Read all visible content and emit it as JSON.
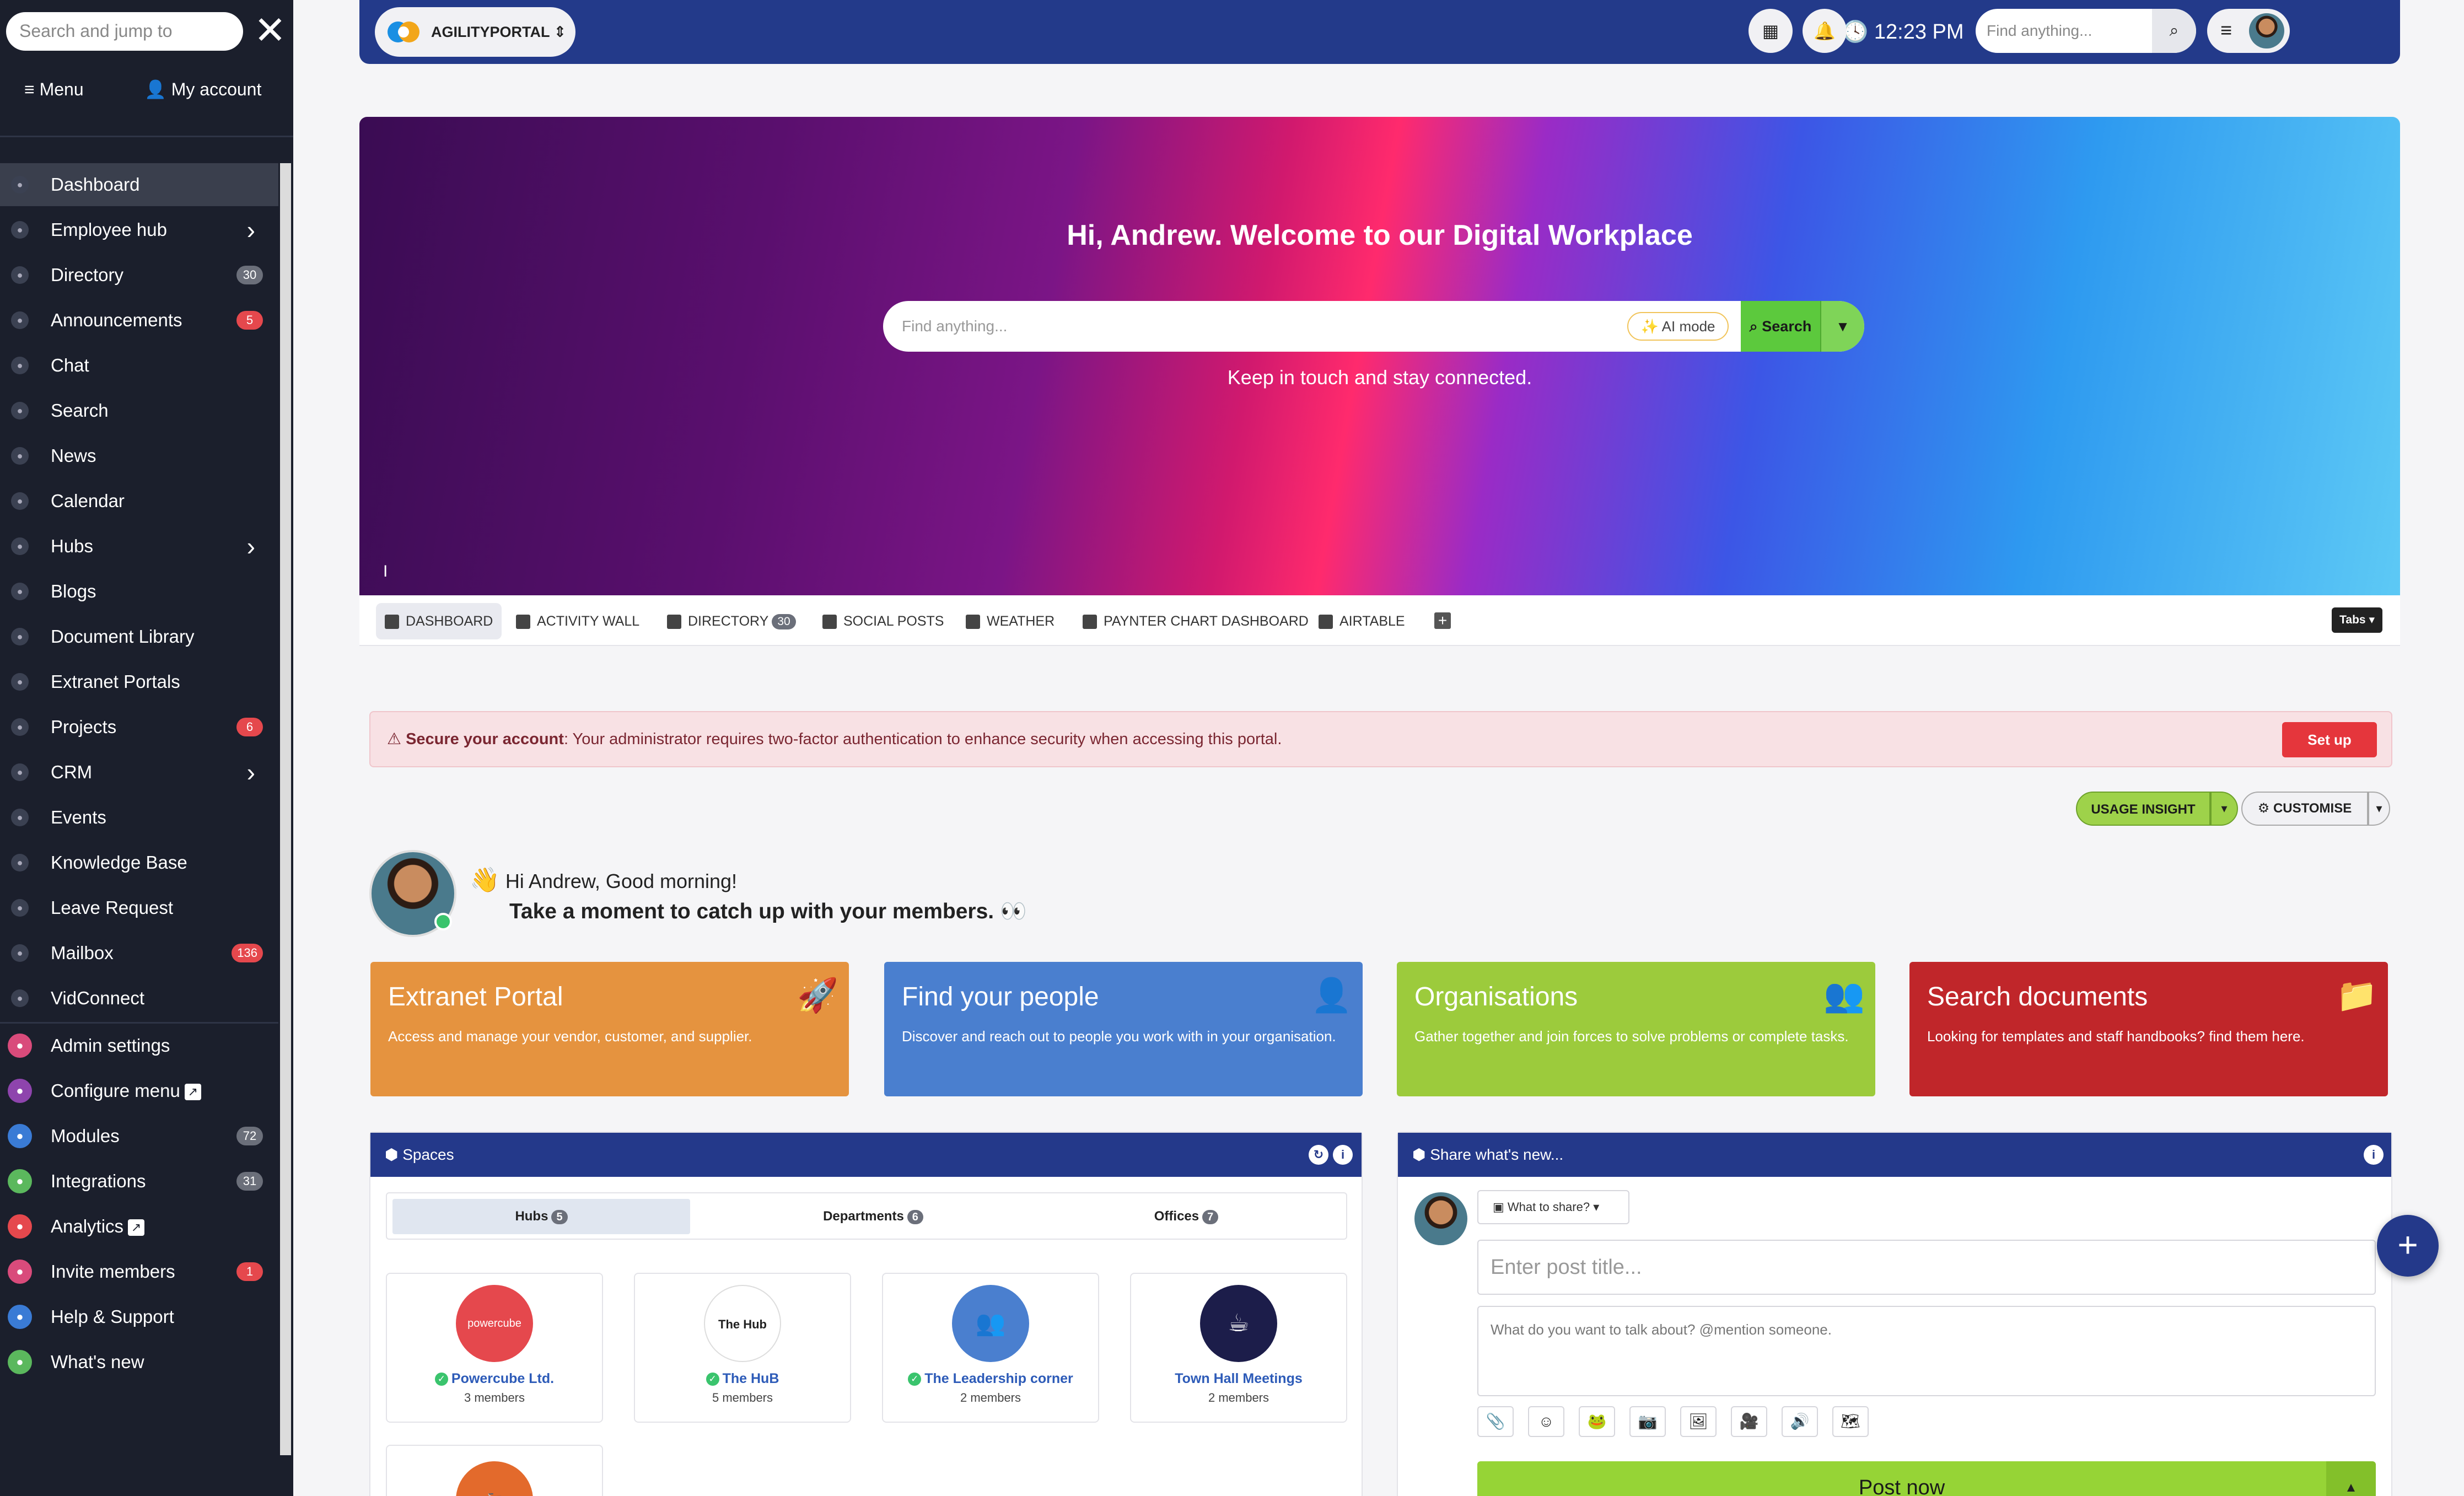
{
  "sidebar": {
    "search_placeholder": "Search and jump to",
    "close_glyph": "✕",
    "menu_label": "Menu",
    "account_label": "My account",
    "items": [
      {
        "label": "Dashboard",
        "icon": "dashboard-icon",
        "active": true
      },
      {
        "label": "Employee hub",
        "icon": "people-icon",
        "chevron": true
      },
      {
        "label": "Directory",
        "icon": "directory-icon",
        "badge": "30",
        "badge_color": "#6b6f7a"
      },
      {
        "label": "Announcements",
        "icon": "megaphone-icon",
        "badge": "5",
        "badge_color": "#e5484d"
      },
      {
        "label": "Chat",
        "icon": "chat-icon"
      },
      {
        "label": "Search",
        "icon": "search-icon"
      },
      {
        "label": "News",
        "icon": "news-icon"
      },
      {
        "label": "Calendar",
        "icon": "calendar-icon"
      },
      {
        "label": "Hubs",
        "icon": "hubs-icon",
        "chevron": true
      },
      {
        "label": "Blogs",
        "icon": "blog-icon"
      },
      {
        "label": "Document Library",
        "icon": "folder-icon"
      },
      {
        "label": "Extranet Portals",
        "icon": "portal-icon"
      },
      {
        "label": "Projects",
        "icon": "projects-icon",
        "badge": "6",
        "badge_color": "#e5484d"
      },
      {
        "label": "CRM",
        "icon": "crm-icon",
        "chevron": true
      },
      {
        "label": "Events",
        "icon": "events-icon"
      },
      {
        "label": "Knowledge Base",
        "icon": "book-icon"
      },
      {
        "label": "Leave Request",
        "icon": "plane-icon"
      },
      {
        "label": "Mailbox",
        "icon": "mailbox-icon",
        "badge": "136",
        "badge_color": "#e5484d"
      },
      {
        "label": "VidConnect",
        "icon": "video-icon"
      }
    ],
    "admin_items": [
      {
        "label": "Admin settings",
        "icon": "settings-icon",
        "color": "#d94b7b"
      },
      {
        "label": "Configure menu",
        "icon": "menu-icon",
        "color": "#8e44ad",
        "external": true
      },
      {
        "label": "Modules",
        "icon": "modules-icon",
        "color": "#3a7bd5",
        "badge": "72",
        "badge_color": "#6b6f7a"
      },
      {
        "label": "Integrations",
        "icon": "plug-icon",
        "color": "#5bb85d",
        "badge": "31",
        "badge_color": "#6b6f7a"
      },
      {
        "label": "Analytics",
        "icon": "analytics-icon",
        "color": "#e5484d",
        "external": true
      },
      {
        "label": "Invite members",
        "icon": "invite-icon",
        "color": "#d94b7b",
        "badge": "1",
        "badge_color": "#e5484d"
      },
      {
        "label": "Help & Support",
        "icon": "help-icon",
        "color": "#3a7bd5"
      },
      {
        "label": "What's new",
        "icon": "bulb-icon",
        "color": "#5bb85d"
      }
    ]
  },
  "topbar": {
    "portal_name": "AGILITYPORTAL",
    "time": "12:23 PM",
    "search_placeholder": "Find anything..."
  },
  "hero": {
    "title": "Hi, Andrew. Welcome to our Digital Workplace",
    "search_placeholder": "Find anything...",
    "ai_mode": "AI mode",
    "search_button": "Search",
    "subtitle": "Keep in touch and stay connected.",
    "cursor": "I"
  },
  "tabs": [
    {
      "label": "DASHBOARD",
      "icon": "home-icon",
      "active": true
    },
    {
      "label": "ACTIVITY WALL",
      "icon": "list-icon"
    },
    {
      "label": "DIRECTORY",
      "icon": "directory-icon",
      "badge": "30"
    },
    {
      "label": "SOCIAL POSTS",
      "icon": "square-icon"
    },
    {
      "label": "WEATHER",
      "icon": "square-icon"
    },
    {
      "label": "PAYNTER CHART DASHBOARD",
      "icon": "square-icon"
    },
    {
      "label": "AIRTABLE",
      "icon": "square-icon"
    }
  ],
  "tabs_dropdown": "Tabs ▾",
  "alert": {
    "title": "Secure your account",
    "message": ": Your administrator requires two-factor authentication to enhance security when accessing this portal.",
    "button": "Set up"
  },
  "actions": {
    "usage": "USAGE INSIGHT",
    "customise": "CUSTOMISE"
  },
  "greeting": {
    "line1": "Hi Andrew, Good morning!",
    "line2": "Take a moment to catch up with your members.",
    "wave": "👋",
    "eyes": "👀"
  },
  "cards": [
    {
      "title": "Extranet Portal",
      "desc": "Access and manage your vendor, customer, and supplier.",
      "color": "#e5933f",
      "icon": "rocket-icon",
      "glyph": "🚀"
    },
    {
      "title": "Find your people",
      "desc": "Discover and reach out to people you work with in your organisation.",
      "color": "#4a7fcf",
      "icon": "address-book-icon",
      "glyph": "👤"
    },
    {
      "title": "Organisations",
      "desc": "Gather together and join forces to solve problems or complete tasks.",
      "color": "#9ccb3c",
      "icon": "users-icon",
      "glyph": "👥"
    },
    {
      "title": "Search documents",
      "desc": "Looking for templates and staff handbooks? find them here.",
      "color": "#c0262a",
      "icon": "folder-plus-icon",
      "glyph": "📁"
    }
  ],
  "spaces": {
    "title": "Spaces",
    "segments": [
      {
        "label": "Hubs",
        "count": "5",
        "active": true
      },
      {
        "label": "Departments",
        "count": "6"
      },
      {
        "label": "Offices",
        "count": "7"
      }
    ],
    "hubs": [
      {
        "name": "Powercube Ltd.",
        "members": "3 members",
        "color": "#e5484d",
        "logo": "powercube",
        "verified": true
      },
      {
        "name": "The HuB",
        "members": "5 members",
        "color": "#ffffff",
        "logo": "The Hub",
        "verified": true
      },
      {
        "name": "The Leadership corner",
        "members": "2 members",
        "color": "#4a7fcf",
        "logo": "👥",
        "verified": true
      },
      {
        "name": "Town Hall Meetings",
        "members": "2 members",
        "color": "#1c1d4a",
        "logo": "☕",
        "verified": false
      }
    ],
    "extra_hub_color": "#e36a2c"
  },
  "share": {
    "title": "Share what's new...",
    "what_to_share": "What to share? ▾",
    "title_placeholder": "Enter post title...",
    "body_placeholder": "What do you want to talk about? @mention someone.",
    "post_button": "Post now",
    "tools": [
      "paperclip-icon",
      "emoji-icon",
      "gif-icon",
      "camera-icon",
      "image-icon",
      "video-icon",
      "audio-icon",
      "map-icon"
    ]
  },
  "fab": "+"
}
